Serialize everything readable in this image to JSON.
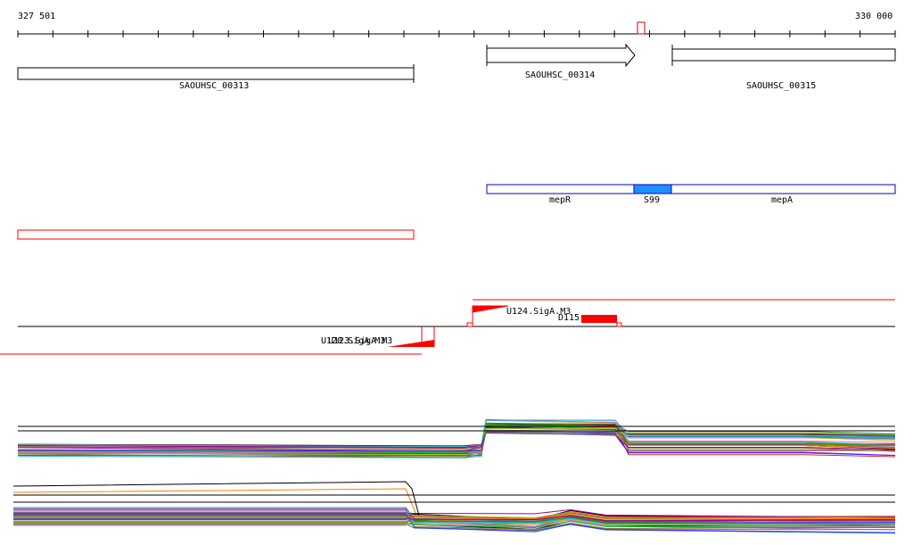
{
  "ruler": {
    "start_label": "327 501",
    "end_label": "330 000"
  },
  "genes": [
    {
      "label": "SAOUHSC_00313"
    },
    {
      "label": "SAOUHSC_00314"
    },
    {
      "label": "SAOUHSC_00315"
    }
  ],
  "transcripts": [
    {
      "label": "mepR"
    },
    {
      "label": "S99"
    },
    {
      "label": "mepA"
    }
  ],
  "promoters": [
    {
      "label": "U124.SigA.M3"
    },
    {
      "label": "D115"
    },
    {
      "label": "U120.SigA.M3"
    },
    {
      "label": "U123.SigA.M3"
    }
  ],
  "colors": {
    "accent": "#ff0000",
    "transcript": "#0000cc",
    "s99": "#1e90ff"
  },
  "palette": [
    "#000000",
    "#ff7f00",
    "#228b22",
    "#1f77b4",
    "#d62728",
    "#9467bd",
    "#8c564b",
    "#e377c2",
    "#7f7f7f",
    "#bcbd22",
    "#17becf",
    "#00cc00",
    "#990099",
    "#3333ff",
    "#996633"
  ]
}
